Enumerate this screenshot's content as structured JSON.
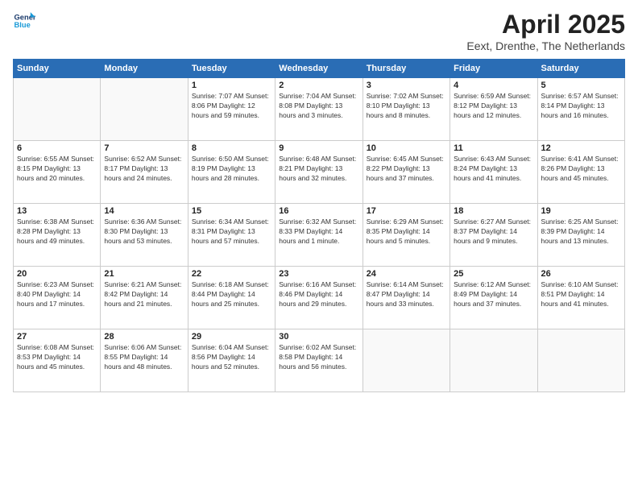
{
  "header": {
    "logo_line1": "General",
    "logo_line2": "Blue",
    "month_year": "April 2025",
    "location": "Eext, Drenthe, The Netherlands"
  },
  "days_of_week": [
    "Sunday",
    "Monday",
    "Tuesday",
    "Wednesday",
    "Thursday",
    "Friday",
    "Saturday"
  ],
  "weeks": [
    [
      {
        "day": "",
        "info": ""
      },
      {
        "day": "",
        "info": ""
      },
      {
        "day": "1",
        "info": "Sunrise: 7:07 AM\nSunset: 8:06 PM\nDaylight: 12 hours and 59 minutes."
      },
      {
        "day": "2",
        "info": "Sunrise: 7:04 AM\nSunset: 8:08 PM\nDaylight: 13 hours and 3 minutes."
      },
      {
        "day": "3",
        "info": "Sunrise: 7:02 AM\nSunset: 8:10 PM\nDaylight: 13 hours and 8 minutes."
      },
      {
        "day": "4",
        "info": "Sunrise: 6:59 AM\nSunset: 8:12 PM\nDaylight: 13 hours and 12 minutes."
      },
      {
        "day": "5",
        "info": "Sunrise: 6:57 AM\nSunset: 8:14 PM\nDaylight: 13 hours and 16 minutes."
      }
    ],
    [
      {
        "day": "6",
        "info": "Sunrise: 6:55 AM\nSunset: 8:15 PM\nDaylight: 13 hours and 20 minutes."
      },
      {
        "day": "7",
        "info": "Sunrise: 6:52 AM\nSunset: 8:17 PM\nDaylight: 13 hours and 24 minutes."
      },
      {
        "day": "8",
        "info": "Sunrise: 6:50 AM\nSunset: 8:19 PM\nDaylight: 13 hours and 28 minutes."
      },
      {
        "day": "9",
        "info": "Sunrise: 6:48 AM\nSunset: 8:21 PM\nDaylight: 13 hours and 32 minutes."
      },
      {
        "day": "10",
        "info": "Sunrise: 6:45 AM\nSunset: 8:22 PM\nDaylight: 13 hours and 37 minutes."
      },
      {
        "day": "11",
        "info": "Sunrise: 6:43 AM\nSunset: 8:24 PM\nDaylight: 13 hours and 41 minutes."
      },
      {
        "day": "12",
        "info": "Sunrise: 6:41 AM\nSunset: 8:26 PM\nDaylight: 13 hours and 45 minutes."
      }
    ],
    [
      {
        "day": "13",
        "info": "Sunrise: 6:38 AM\nSunset: 8:28 PM\nDaylight: 13 hours and 49 minutes."
      },
      {
        "day": "14",
        "info": "Sunrise: 6:36 AM\nSunset: 8:30 PM\nDaylight: 13 hours and 53 minutes."
      },
      {
        "day": "15",
        "info": "Sunrise: 6:34 AM\nSunset: 8:31 PM\nDaylight: 13 hours and 57 minutes."
      },
      {
        "day": "16",
        "info": "Sunrise: 6:32 AM\nSunset: 8:33 PM\nDaylight: 14 hours and 1 minute."
      },
      {
        "day": "17",
        "info": "Sunrise: 6:29 AM\nSunset: 8:35 PM\nDaylight: 14 hours and 5 minutes."
      },
      {
        "day": "18",
        "info": "Sunrise: 6:27 AM\nSunset: 8:37 PM\nDaylight: 14 hours and 9 minutes."
      },
      {
        "day": "19",
        "info": "Sunrise: 6:25 AM\nSunset: 8:39 PM\nDaylight: 14 hours and 13 minutes."
      }
    ],
    [
      {
        "day": "20",
        "info": "Sunrise: 6:23 AM\nSunset: 8:40 PM\nDaylight: 14 hours and 17 minutes."
      },
      {
        "day": "21",
        "info": "Sunrise: 6:21 AM\nSunset: 8:42 PM\nDaylight: 14 hours and 21 minutes."
      },
      {
        "day": "22",
        "info": "Sunrise: 6:18 AM\nSunset: 8:44 PM\nDaylight: 14 hours and 25 minutes."
      },
      {
        "day": "23",
        "info": "Sunrise: 6:16 AM\nSunset: 8:46 PM\nDaylight: 14 hours and 29 minutes."
      },
      {
        "day": "24",
        "info": "Sunrise: 6:14 AM\nSunset: 8:47 PM\nDaylight: 14 hours and 33 minutes."
      },
      {
        "day": "25",
        "info": "Sunrise: 6:12 AM\nSunset: 8:49 PM\nDaylight: 14 hours and 37 minutes."
      },
      {
        "day": "26",
        "info": "Sunrise: 6:10 AM\nSunset: 8:51 PM\nDaylight: 14 hours and 41 minutes."
      }
    ],
    [
      {
        "day": "27",
        "info": "Sunrise: 6:08 AM\nSunset: 8:53 PM\nDaylight: 14 hours and 45 minutes."
      },
      {
        "day": "28",
        "info": "Sunrise: 6:06 AM\nSunset: 8:55 PM\nDaylight: 14 hours and 48 minutes."
      },
      {
        "day": "29",
        "info": "Sunrise: 6:04 AM\nSunset: 8:56 PM\nDaylight: 14 hours and 52 minutes."
      },
      {
        "day": "30",
        "info": "Sunrise: 6:02 AM\nSunset: 8:58 PM\nDaylight: 14 hours and 56 minutes."
      },
      {
        "day": "",
        "info": ""
      },
      {
        "day": "",
        "info": ""
      },
      {
        "day": "",
        "info": ""
      }
    ]
  ]
}
